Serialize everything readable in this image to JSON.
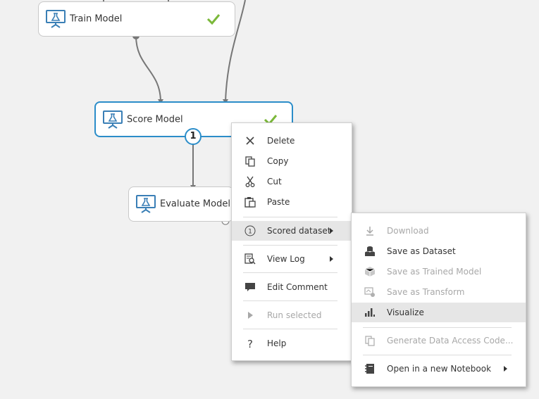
{
  "colors": {
    "accent": "#2b8dc9",
    "check": "#7bb83a",
    "canvas": "#f1f1f1"
  },
  "modules": {
    "train": {
      "label": "Train Model",
      "status_icon": "check-icon"
    },
    "score": {
      "label": "Score Model",
      "status_icon": "check-icon",
      "output_port": "1"
    },
    "evaluate": {
      "label": "Evaluate Model"
    }
  },
  "context_menu": {
    "items": [
      {
        "label": "Delete",
        "icon": "delete-icon"
      },
      {
        "label": "Copy",
        "icon": "copy-icon"
      },
      {
        "label": "Cut",
        "icon": "cut-icon"
      },
      {
        "label": "Paste",
        "icon": "paste-icon"
      },
      {
        "label": "Scored dataset",
        "icon": "port-1-icon",
        "port": "1",
        "submenu": true
      },
      {
        "label": "View Log",
        "icon": "view-log-icon",
        "submenu": true
      },
      {
        "label": "Edit Comment",
        "icon": "comment-icon"
      },
      {
        "label": "Run selected",
        "icon": "run-icon",
        "disabled": true
      },
      {
        "label": "Help",
        "icon": "help-icon"
      }
    ]
  },
  "submenu": {
    "items": [
      {
        "label": "Download",
        "icon": "download-icon",
        "disabled": true
      },
      {
        "label": "Save as Dataset",
        "icon": "dataset-icon"
      },
      {
        "label": "Save as Trained Model",
        "icon": "trained-model-icon",
        "disabled": true
      },
      {
        "label": "Save as Transform",
        "icon": "transform-icon",
        "disabled": true
      },
      {
        "label": "Visualize",
        "icon": "visualize-icon",
        "highlighted": true
      },
      {
        "label": "Generate Data Access Code...",
        "icon": "generate-code-icon",
        "disabled": true
      },
      {
        "label": "Open in a new Notebook",
        "icon": "notebook-icon",
        "submenu": true
      }
    ]
  }
}
